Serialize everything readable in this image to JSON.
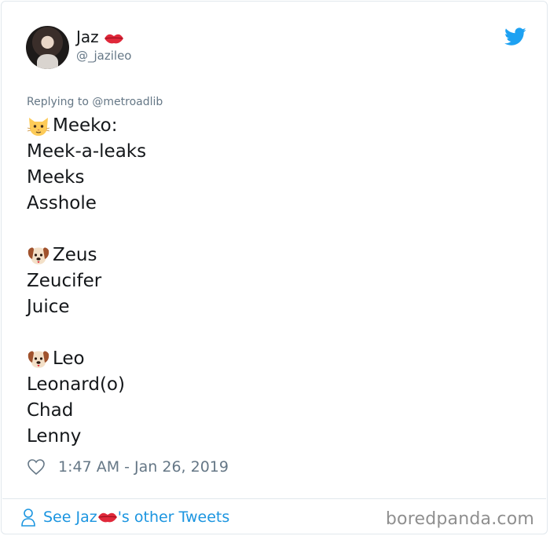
{
  "tweet": {
    "author_name": "Jaz",
    "author_handle": "@_jazileo",
    "replying_to": "Replying to @metroadlib",
    "lines": [
      {
        "emoji": "cat-face",
        "text": " Meeko:"
      },
      {
        "emoji": "",
        "text": "Meek-a-leaks"
      },
      {
        "emoji": "",
        "text": "Meeks"
      },
      {
        "emoji": "",
        "text": "Asshole"
      },
      {
        "emoji": "",
        "text": ""
      },
      {
        "emoji": "dog-face",
        "text": "Zeus"
      },
      {
        "emoji": "",
        "text": "Zeucifer"
      },
      {
        "emoji": "",
        "text": "Juice"
      },
      {
        "emoji": "",
        "text": ""
      },
      {
        "emoji": "dog-face",
        "text": "Leo"
      },
      {
        "emoji": "",
        "text": "Leonard(o)"
      },
      {
        "emoji": "",
        "text": "Chad"
      },
      {
        "emoji": "",
        "text": "Lenny"
      }
    ],
    "timestamp": "1:47 AM - Jan 26, 2019"
  },
  "footer": {
    "see_prefix": "See Jaz",
    "see_suffix": "'s other Tweets"
  },
  "watermark": "boredpanda.com",
  "colors": {
    "link": "#1b95e0",
    "muted": "#657786",
    "lips": "#e0283a"
  }
}
